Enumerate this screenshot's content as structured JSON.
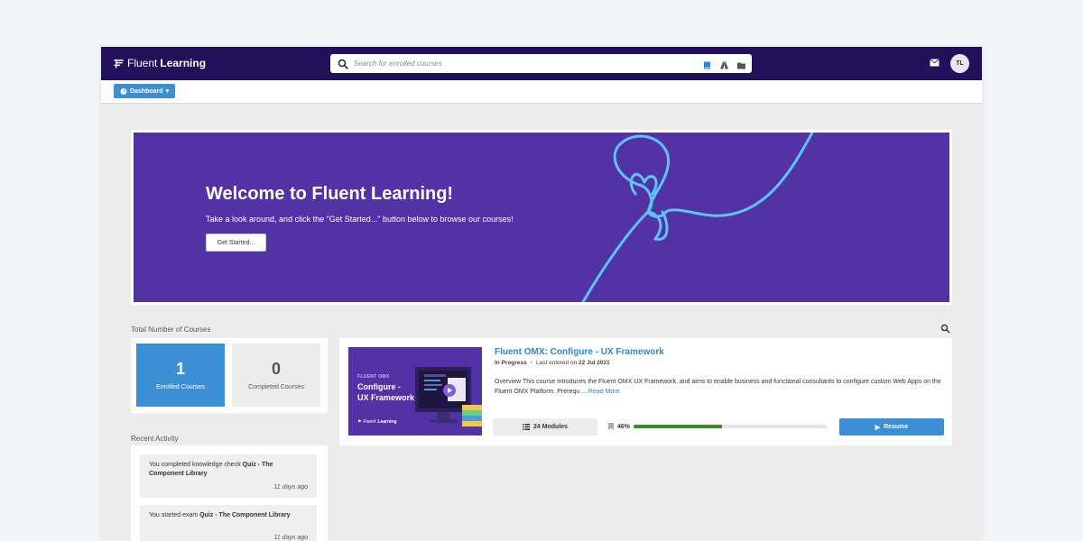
{
  "header": {
    "brand_regular": "Fluent",
    "brand_bold": "Learning",
    "search_placeholder": "Search for enrolled courses",
    "search_icons": [
      "search-icon",
      "book-icon",
      "road-icon",
      "folder-icon"
    ],
    "mail_icon": "mail-icon",
    "avatar_initials": "TL"
  },
  "subnav": {
    "dashboard_label": "Dashboard"
  },
  "hero": {
    "title": "Welcome to Fluent Learning!",
    "subtitle": "Take a look around, and click the \"Get Started...\" button below to browse our courses!",
    "button_label": "Get Started..."
  },
  "stats": {
    "section_label": "Total Number of Courses",
    "enrolled": {
      "count": "1",
      "label": "Enrolled Courses"
    },
    "completed": {
      "count": "0",
      "label": "Completed Courses"
    }
  },
  "recent": {
    "section_label": "Recent Activity",
    "items": [
      {
        "prefix": "You completed knowledge check ",
        "bold": "Quiz - The Component Library",
        "time": "11 days ago"
      },
      {
        "prefix": "You started exam ",
        "bold": "Quiz - The Component Library",
        "time": "11 days ago"
      }
    ]
  },
  "course": {
    "thumb_tag": "FLUENT OMX",
    "thumb_title_1": "Configure -",
    "thumb_title_2": "UX Framework",
    "thumb_brand_regular": "Fluent",
    "thumb_brand_bold": "Learning",
    "title": "Fluent OMX: Configure - UX Framework",
    "status": "In Progress",
    "last_entered_label": "Last entered on",
    "last_entered_date": "22 Jul 2021",
    "description": "Overview This course introduces the Fluent OMX UX Framework, and aims to enable business and functional consultants to configure custom Web Apps on the Fluent OMX Platform. Prerequ ...",
    "read_more": "Read More",
    "modules_label": "24 Modules",
    "progress_text": "46%",
    "progress_value": 0.46,
    "resume_label": "Resume"
  },
  "colors": {
    "navbar": "#22105a",
    "hero": "#5232a4",
    "accent": "#3b8fd4",
    "progress": "#3b8a2f",
    "link": "#2f86c9"
  }
}
